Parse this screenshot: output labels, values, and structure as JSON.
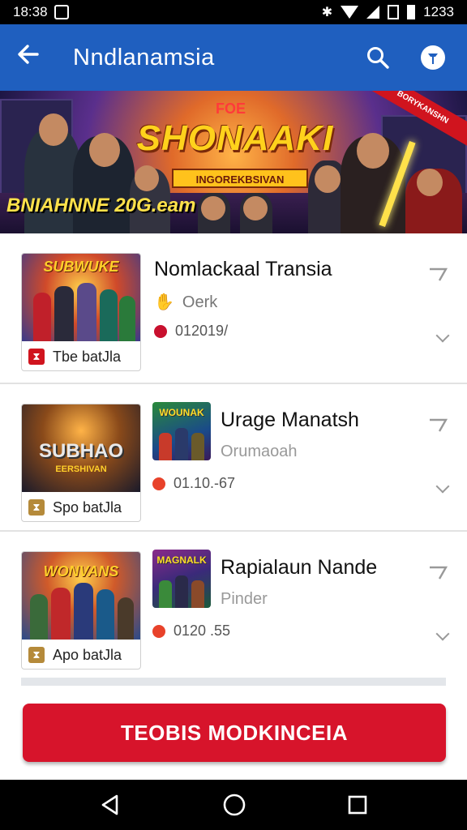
{
  "status_bar": {
    "time": "18:38",
    "right_text": "1233"
  },
  "app_bar": {
    "title": "Nndlanamsia"
  },
  "banner": {
    "pre_title": "FOE",
    "title": "SHONAAKI",
    "subtitle": "INGOREKBSIVAN",
    "bottom_text": "BNIAHNNE 20G.eam",
    "ribbon": "BORYKANSHN"
  },
  "items": [
    {
      "thumb_title": "SUBWUKE",
      "thumb_label": "Tbe batJla",
      "title": "Nomlackaal Transia",
      "sub": "Oerk",
      "meta": "012019/"
    },
    {
      "thumb_title": "SUBHAO",
      "thumb_sub": "EERSHIVAN",
      "thumb_label": "Spo batJla",
      "small_thumb_title": "WOUNAK",
      "title": "Urage Manatsh",
      "sub": "Orumaoah",
      "meta": "01.10.-67"
    },
    {
      "thumb_title": "WONVANS",
      "thumb_label": "Apo batJla",
      "small_thumb_title": "MAGNALK",
      "title": "Rapialaun Nande",
      "sub": "Pinder",
      "meta": "0120 .55"
    }
  ],
  "cta": {
    "label": "TEOBIS MODKINCEIA"
  },
  "colors": {
    "app_bar": "#1f5fbf",
    "accent_red": "#d7142b",
    "status_bar": "#000000"
  }
}
